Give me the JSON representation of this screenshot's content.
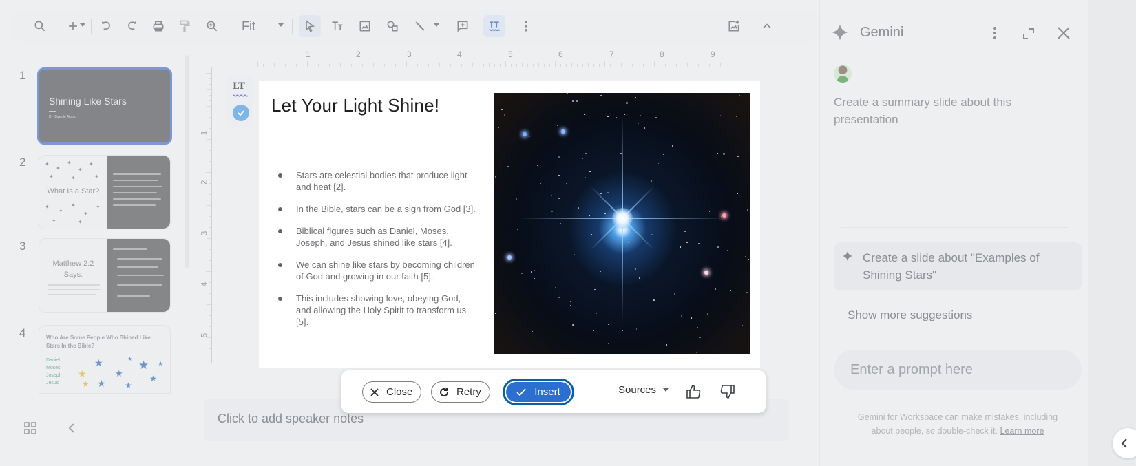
{
  "toolbar": {
    "zoom_value": "Fit",
    "buttons": {
      "search": "search-icon",
      "new": "plus-icon",
      "undo": "undo-icon",
      "redo": "redo-icon",
      "print": "print-icon",
      "paint_format": "paint-format-icon",
      "zoom": "zoom-in-icon",
      "select": "cursor-icon",
      "text_box": "text-box-icon",
      "image": "image-icon",
      "shape": "shape-icon",
      "line": "line-icon",
      "comment": "add-comment-icon",
      "spellcheck": "spellcheck-icon",
      "more": "more-vert-icon",
      "generate_image": "generate-image-icon",
      "collapse": "chevron-up-icon"
    }
  },
  "filmstrip": {
    "slides": [
      {
        "number": "1",
        "title": "Shining Like Stars",
        "subtitle": "Dr Oluwole Akapo"
      },
      {
        "number": "2",
        "title": "What Is a Star?",
        "body": "Stars are huge celestial bodies made mostly of hydrogen and helium that produce light and heat. Aside from our sun, there are several billion stars."
      },
      {
        "number": "3",
        "title": "Matthew 2:2 Says:"
      },
      {
        "number": "4",
        "title": "Who Are Some People Who Shined Like Stars In the Bible?",
        "list": [
          "Daniel",
          "Moses",
          "Joseph",
          "Jesus"
        ]
      }
    ]
  },
  "ruler": {
    "horizontal": [
      "1",
      "2",
      "3",
      "4",
      "5",
      "6",
      "7",
      "8",
      "9"
    ],
    "vertical": [
      "1",
      "2",
      "3",
      "4",
      "5"
    ]
  },
  "slide": {
    "title": "Let Your Light Shine!",
    "bullets": [
      "Stars are celestial bodies that produce light and heat [2].",
      "In the Bible, stars can be a sign from God [3].",
      "Biblical figures such as Daniel, Moses, Joseph, and Jesus shined like stars [4].",
      "We can shine like stars by becoming children of God and growing in our faith [5].",
      "This includes showing love, obeying God, and allowing the Holy Spirit to transform us [5]."
    ],
    "image_alt": "bright star in night sky"
  },
  "side_chip": {
    "lt_label": "LT"
  },
  "action_bar": {
    "close": "Close",
    "retry": "Retry",
    "insert": "Insert",
    "sources": "Sources"
  },
  "notes": {
    "placeholder": "Click to add speaker notes"
  },
  "gemini": {
    "title": "Gemini",
    "user_prompt": "Create a summary slide about this presentation",
    "suggestion": "Create a slide about \"Examples of Shining Stars\"",
    "show_more": "Show more suggestions",
    "input_placeholder": "Enter a prompt here",
    "disclaimer": "Gemini for Workspace can make mistakes, including about people, so double-check it.",
    "learn_more": "Learn more"
  },
  "colors": {
    "insert_blue": "#2b6fd1",
    "insert_ring": "#0b5fa0",
    "selected_slide_border": "#7a98d8",
    "check_badge": "#7eb6ea"
  }
}
